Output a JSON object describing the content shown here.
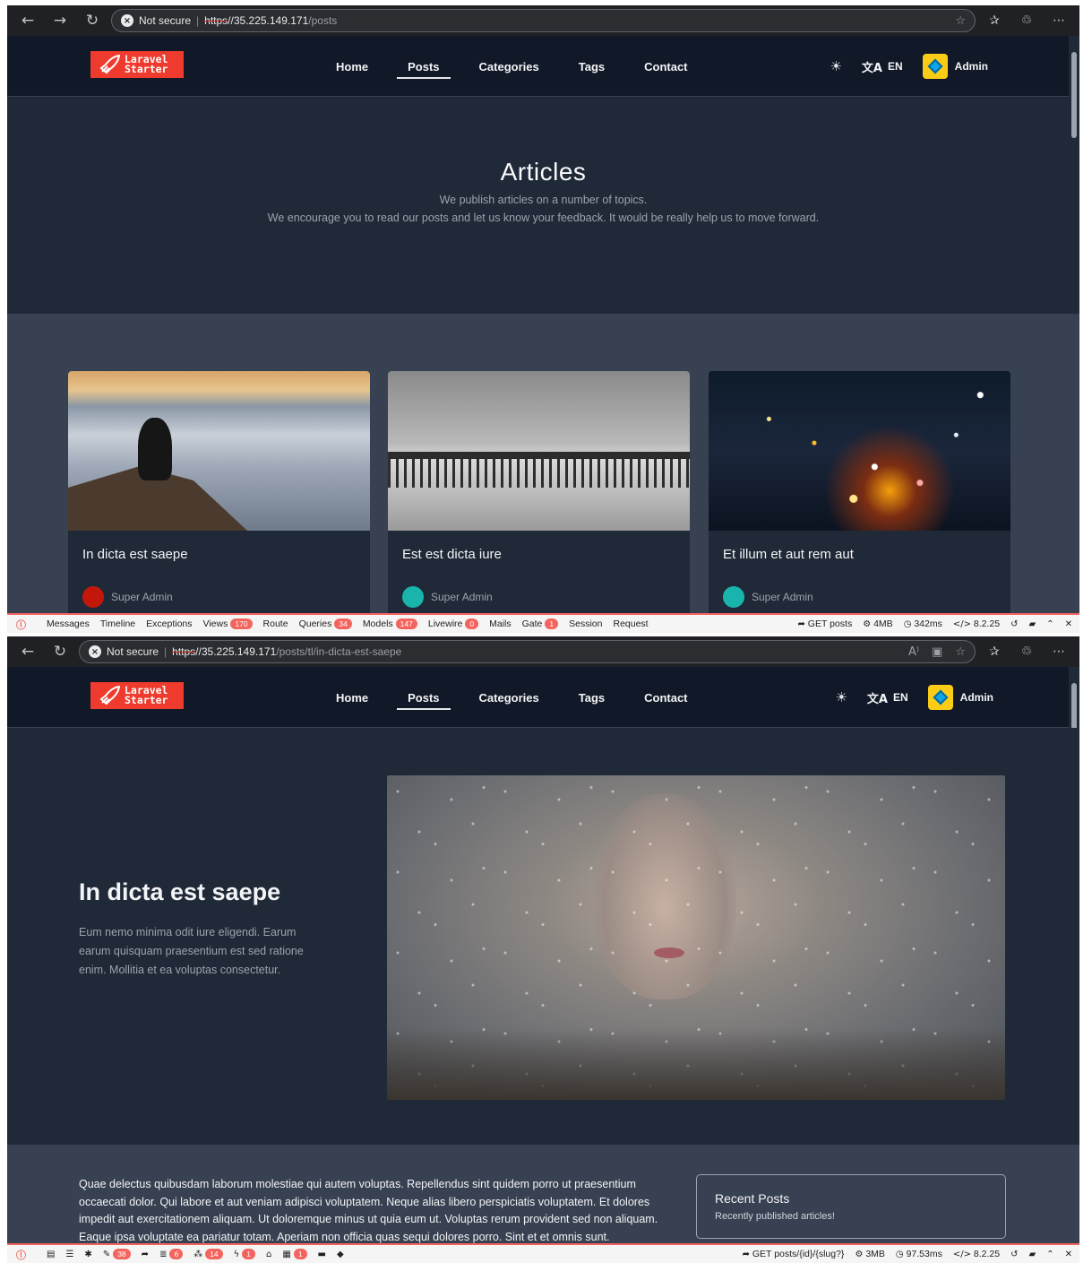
{
  "screen1": {
    "browser": {
      "security": "Not secure",
      "url_protocol": "https",
      "url_host": "//35.225.149.171",
      "url_path": "/posts"
    },
    "header": {
      "logo_line1": "Laravel",
      "logo_line2": "Starter",
      "nav": [
        "Home",
        "Posts",
        "Categories",
        "Tags",
        "Contact"
      ],
      "active_nav": "Posts",
      "lang": "EN",
      "user": "Admin"
    },
    "hero": {
      "title": "Articles",
      "line1": "We publish articles on a number of topics.",
      "line2": "We encourage you to read our posts and let us know your feedback. It would be really help us to move forward."
    },
    "cards": [
      {
        "title": "In dicta est saepe",
        "author": "Super Admin",
        "avatar_color": "#c4170c"
      },
      {
        "title": "Est est dicta iure",
        "author": "Super Admin",
        "avatar_color": "#19b5ad"
      },
      {
        "title": "Et illum et aut rem aut",
        "author": "Super Admin",
        "avatar_color": "#19b5ad"
      }
    ],
    "debugbar": {
      "tabs": [
        {
          "label": "Messages",
          "badge": ""
        },
        {
          "label": "Timeline",
          "badge": ""
        },
        {
          "label": "Exceptions",
          "badge": ""
        },
        {
          "label": "Views",
          "badge": "170"
        },
        {
          "label": "Route",
          "badge": ""
        },
        {
          "label": "Queries",
          "badge": "34"
        },
        {
          "label": "Models",
          "badge": "147"
        },
        {
          "label": "Livewire",
          "badge": "0"
        },
        {
          "label": "Mails",
          "badge": ""
        },
        {
          "label": "Gate",
          "badge": "1"
        },
        {
          "label": "Session",
          "badge": ""
        },
        {
          "label": "Request",
          "badge": ""
        }
      ],
      "request": "GET posts",
      "memory": "4MB",
      "time": "342ms",
      "php": "8.2.25"
    }
  },
  "screen2": {
    "browser": {
      "security": "Not secure",
      "url_protocol": "https",
      "url_host": "//35.225.149.171",
      "url_path": "/posts/tl/in-dicta-est-saepe"
    },
    "header": {
      "logo_line1": "Laravel",
      "logo_line2": "Starter",
      "nav": [
        "Home",
        "Posts",
        "Categories",
        "Tags",
        "Contact"
      ],
      "lang": "EN",
      "user": "Admin"
    },
    "post": {
      "title": "In dicta est saepe",
      "excerpt": "Eum nemo minima odit iure eligendi. Earum earum quisquam praesentium est sed ratione enim. Mollitia et ea voluptas consectetur.",
      "body": "Quae delectus quibusdam laborum molestiae qui autem voluptas. Repellendus sint quidem porro ut praesentium occaecati dolor. Qui labore et aut veniam adipisci voluptatem. Neque alias libero perspiciatis voluptatem. Et dolores impedit aut exercitationem aliquam. Ut doloremque minus ut quia eum ut. Voluptas rerum provident sed non aliquam. Eaque ipsa voluptate ea pariatur totam. Aperiam non officia quas sequi dolores porro. Sint et et omnis sunt."
    },
    "recent": {
      "title": "Recent Posts",
      "subtitle": "Recently published articles!"
    },
    "debugbar": {
      "badges": [
        "38",
        "6",
        "14",
        "1",
        "1"
      ],
      "request": "GET posts/{id}/{slug?}",
      "memory": "3MB",
      "time": "97.53ms",
      "php": "8.2.25"
    }
  }
}
